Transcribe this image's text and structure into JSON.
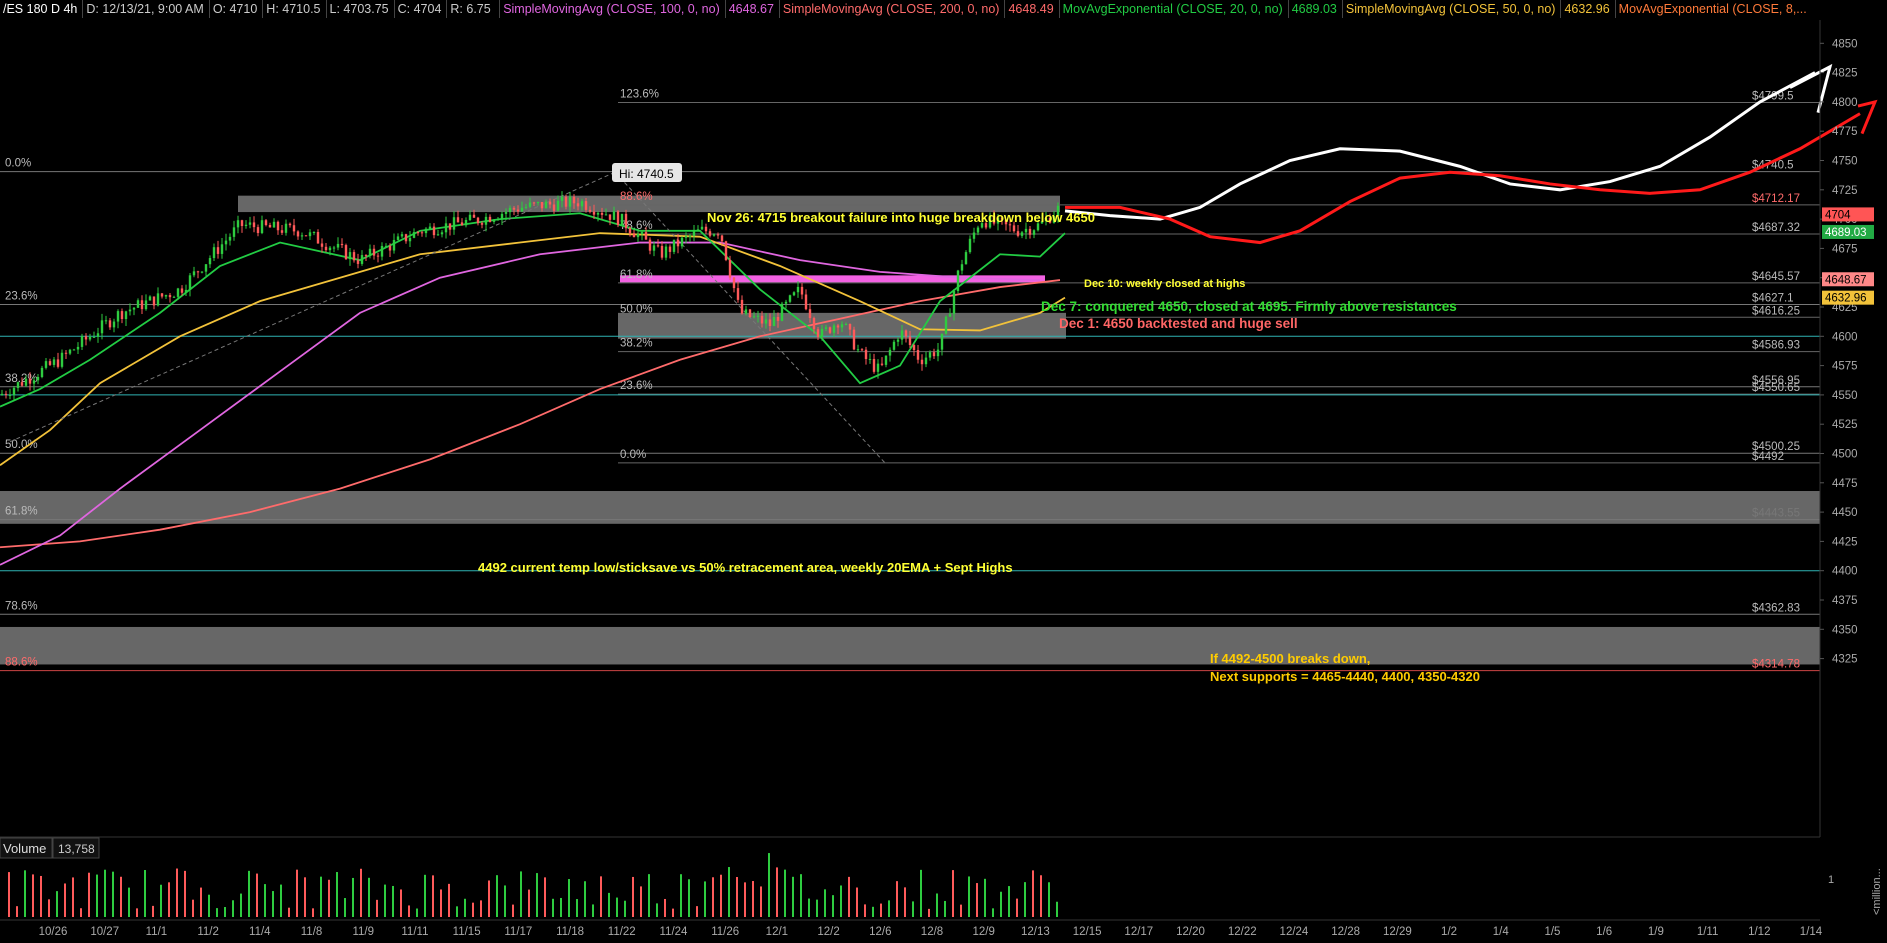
{
  "header": {
    "symbol": "/ES 180 D 4h",
    "date": "D: 12/13/21, 9:00 AM",
    "open": "O: 4710",
    "high": "H: 4710.5",
    "low": "L: 4703.75",
    "close": "C: 4704",
    "range": "R: 6.75",
    "studies": [
      {
        "label": "SimpleMovingAvg (CLOSE, 100, 0, no)",
        "value": "4648.67",
        "color": "#e066e0"
      },
      {
        "label": "SimpleMovingAvg (CLOSE, 200, 0, no)",
        "value": "4648.49",
        "color": "#ff6b6b"
      },
      {
        "label": "MovAvgExponential (CLOSE, 20, 0, no)",
        "value": "4689.03",
        "color": "#22cc44"
      },
      {
        "label": "SimpleMovingAvg (CLOSE, 50, 0, no)",
        "value": "4632.96",
        "color": "#f2c23a"
      },
      {
        "label": "MovAvgExponential (CLOSE, 8,...",
        "value": "",
        "color": "#ff7a3a"
      }
    ]
  },
  "chart_data": {
    "type": "candlestick",
    "y_ticks": [
      4325,
      4350,
      4375,
      4400,
      4425,
      4450,
      4475,
      4500,
      4525,
      4550,
      4575,
      4600,
      4625,
      4650,
      4675,
      4700,
      4725,
      4750,
      4775,
      4800,
      4825,
      4850
    ],
    "ylim": [
      4308,
      4858
    ],
    "x_ticks": [
      "10/26",
      "10/27",
      "11/1",
      "11/2",
      "11/4",
      "11/8",
      "11/9",
      "11/11",
      "11/15",
      "11/17",
      "11/18",
      "11/22",
      "11/24",
      "11/26",
      "12/1",
      "12/2",
      "12/6",
      "12/8",
      "12/9",
      "12/13",
      "12/15",
      "12/17",
      "12/20",
      "12/22",
      "12/24",
      "12/28",
      "12/29",
      "1/2",
      "1/4",
      "1/5",
      "1/6",
      "1/9",
      "1/11",
      "1/12",
      "1/14"
    ],
    "price_labels": [
      {
        "text": "$4799.5",
        "value": 4799.5,
        "color": "#bbbbbb"
      },
      {
        "text": "$4740.5",
        "value": 4740.5,
        "color": "#bbbbbb"
      },
      {
        "text": "$4712.17",
        "value": 4712.17,
        "color": "#ff6b6b"
      },
      {
        "text": "$4687.32",
        "value": 4687.32,
        "color": "#bbbbbb"
      },
      {
        "text": "$4645.57",
        "value": 4645.57,
        "color": "#bbbbbb"
      },
      {
        "text": "$4627.1",
        "value": 4627.1,
        "color": "#bbbbbb"
      },
      {
        "text": "$4616.25",
        "value": 4616.25,
        "color": "#bbbbbb"
      },
      {
        "text": "$4586.93",
        "value": 4586.93,
        "color": "#bbbbbb"
      },
      {
        "text": "$4556.95",
        "value": 4556.95,
        "color": "#bbbbbb"
      },
      {
        "text": "$4550.65",
        "value": 4550.65,
        "color": "#bbbbbb"
      },
      {
        "text": "$4500.25",
        "value": 4500.25,
        "color": "#bbbbbb"
      },
      {
        "text": "$4492",
        "value": 4492,
        "color": "#bbbbbb"
      },
      {
        "text": "$4443.55",
        "value": 4443.55,
        "color": "#777777"
      },
      {
        "text": "$4362.83",
        "value": 4362.83,
        "color": "#bbbbbb"
      },
      {
        "text": "$4314.78",
        "value": 4314.78,
        "color": "#ff6b6b"
      }
    ],
    "value_tags": [
      {
        "text": "4704",
        "value": 4704,
        "bg": "#ff5555",
        "fg": "#000000"
      },
      {
        "text": "4689.03",
        "value": 4689.03,
        "bg": "#22aa44",
        "fg": "#ffffff"
      },
      {
        "text": "4648.67",
        "value": 4648.67,
        "bg": "#ff8888",
        "fg": "#000000"
      },
      {
        "text": "4632.96",
        "value": 4632.96,
        "bg": "#f2c23a",
        "fg": "#000000"
      }
    ],
    "fib_left": [
      {
        "text": "0.0%",
        "value": 4740.5
      },
      {
        "text": "23.6%",
        "value": 4627.1
      },
      {
        "text": "38.2%",
        "value": 4556.95
      },
      {
        "text": "50.0%",
        "value": 4500.25
      },
      {
        "text": "61.8%",
        "value": 4443.55
      },
      {
        "text": "78.6%",
        "value": 4362.83
      },
      {
        "text": "88.6%",
        "value": 4314.78
      }
    ],
    "fib_mid": [
      {
        "text": "123.6%",
        "value": 4799.5
      },
      {
        "text": "88.6%",
        "value": 4712.17
      },
      {
        "text": "78.6%",
        "value": 4687.32
      },
      {
        "text": "61.8%",
        "value": 4645.57
      },
      {
        "text": "50.0%",
        "value": 4616.25
      },
      {
        "text": "38.2%",
        "value": 4586.93
      },
      {
        "text": "23.6%",
        "value": 4550.65
      },
      {
        "text": "0.0%",
        "value": 4492
      }
    ],
    "zones": [
      {
        "from": 4706,
        "to": 4720,
        "color": "#8a8a8a"
      },
      {
        "from": 4598,
        "to": 4620,
        "color": "#8a8a8a"
      },
      {
        "from": 4440,
        "to": 4468,
        "color": "#8a8a8a"
      },
      {
        "from": 4320,
        "to": 4352,
        "color": "#8a8a8a"
      },
      {
        "from": 4646,
        "to": 4652,
        "color": "#ff66ee"
      }
    ],
    "hi_label": "Hi: 4740.5",
    "annotations": [
      {
        "text": "Nov 26: 4715 breakout failure into huge breakdown below 4650",
        "color": "#ffff33"
      },
      {
        "text": "Dec 10: weekly closed at highs",
        "color": "#ffff33"
      },
      {
        "text": "Dec 7: conquered 4650, closed at 4695. Firmly above resistances",
        "color": "#33dd33"
      },
      {
        "text": "Dec 1: 4650 backtested and huge sell",
        "color": "#ff6666"
      },
      {
        "text": "4492 current temp low/sticksave vs 50% retracement area, weekly 20EMA + Sept Highs",
        "color": "#ffff33"
      },
      {
        "text": "If 4492-4500 breaks down,",
        "color": "#ffcc00"
      },
      {
        "text": "Next supports = 4465-4440, 4400, 4350-4320",
        "color": "#ffcc00"
      }
    ],
    "volume": {
      "label": "Volume",
      "value": "13,758",
      "y_tick": "1",
      "unit": "<million..."
    }
  }
}
